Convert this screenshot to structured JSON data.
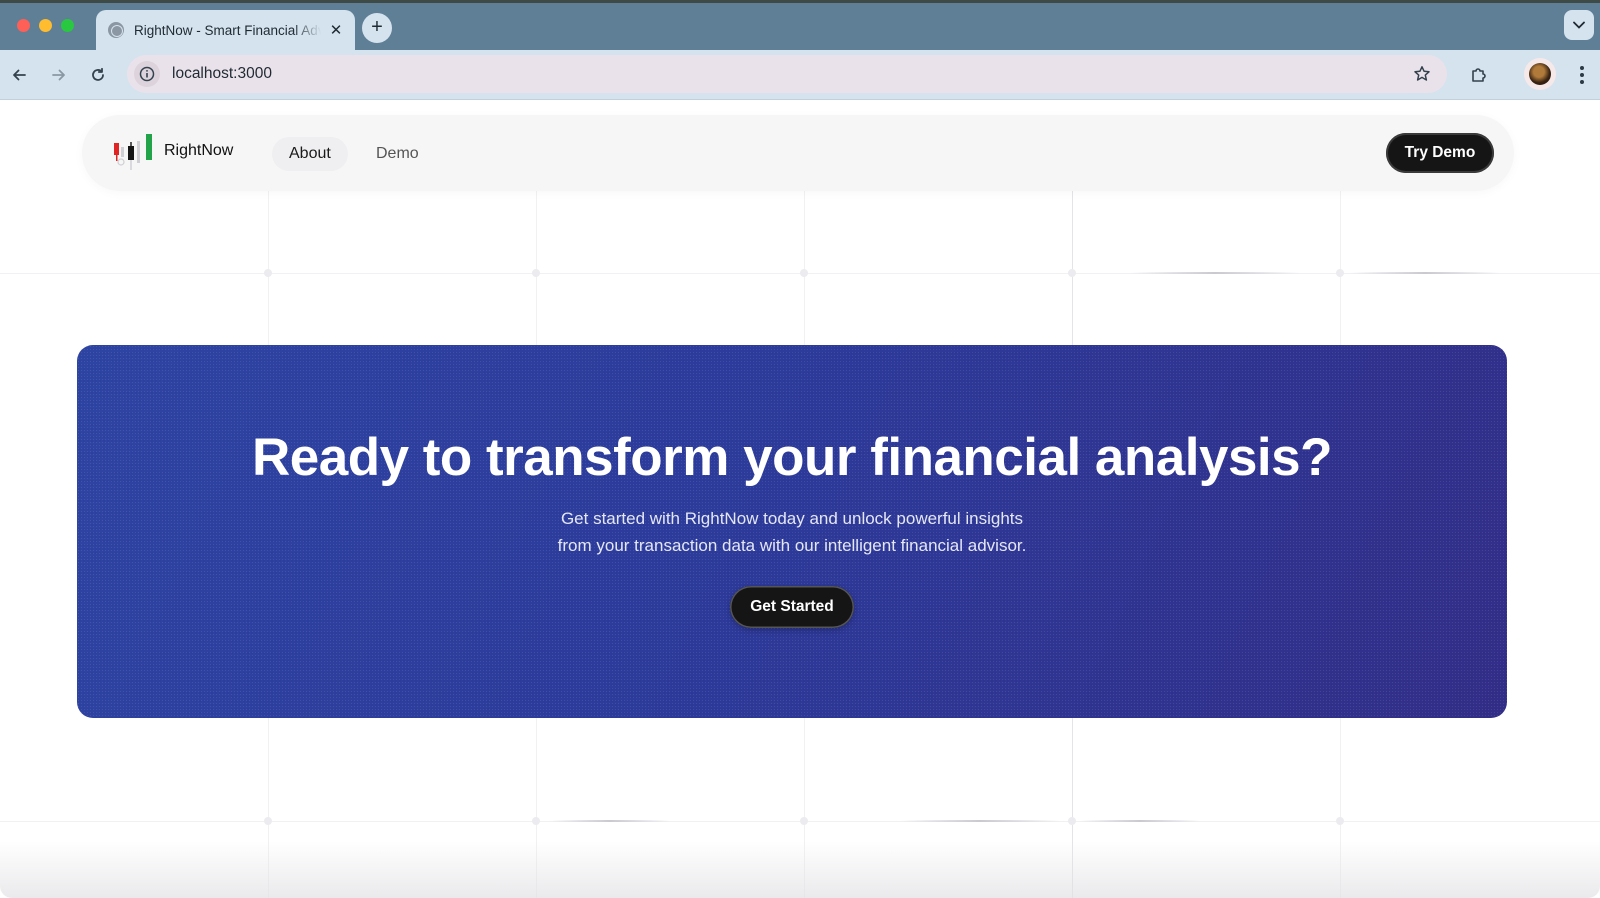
{
  "browser": {
    "tab_title": "RightNow - Smart Financial Advisor",
    "tab_close_icon": "close-icon",
    "new_tab_label": "+",
    "url": "localhost:3000"
  },
  "header": {
    "brand": "RightNow",
    "nav": [
      {
        "label": "About"
      },
      {
        "label": "Demo"
      }
    ],
    "cta_label": "Try Demo"
  },
  "cta": {
    "title": "Ready to transform your financial analysis?",
    "subtitle_line1": "Get started with RightNow today and unlock powerful insights",
    "subtitle_line2": "from your transaction data with our intelligent financial advisor.",
    "button_label": "Get Started"
  },
  "colors": {
    "accent_blue": "#2e44a3",
    "accent_purple": "#322e88",
    "button_dark": "#151515",
    "logo_red": "#e02424",
    "logo_green": "#22a34a"
  }
}
